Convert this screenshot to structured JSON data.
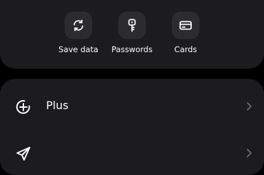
{
  "shortcuts": [
    {
      "label": "Save data",
      "icon": "sync-icon"
    },
    {
      "label": "Passwords",
      "icon": "key-icon"
    },
    {
      "label": "Cards",
      "icon": "credit-card-icon"
    }
  ],
  "menu": {
    "items": [
      {
        "label": "Plus",
        "icon": "plus-circle-icon"
      },
      {
        "label": "",
        "icon": "send-icon"
      }
    ]
  },
  "colors": {
    "background": "#000000",
    "card": "#1c1c1e",
    "icon_tile": "#2c2c2e",
    "text": "#ffffff",
    "chevron": "#6e6e73"
  }
}
